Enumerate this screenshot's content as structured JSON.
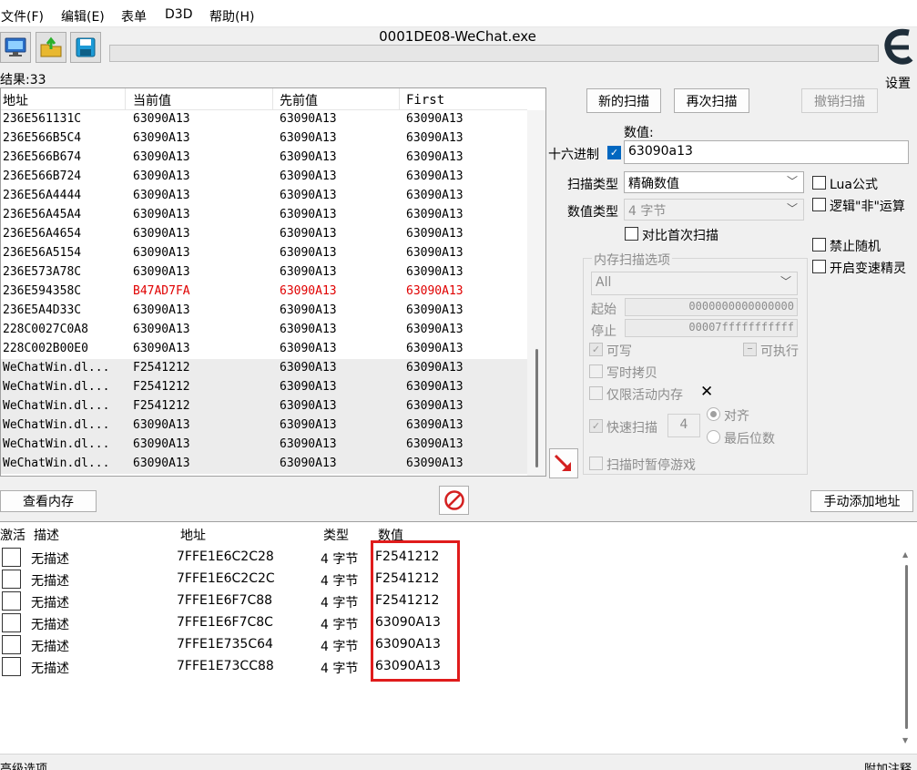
{
  "menu": [
    "文件(F)",
    "编辑(E)",
    "表单",
    "D3D",
    "帮助(H)"
  ],
  "window_title": "0001DE08-WeChat.exe",
  "settings_label": "设置",
  "found_count": "结果:33",
  "results": {
    "columns": [
      "地址",
      "当前值",
      "先前值",
      "First"
    ],
    "rows": [
      [
        "236E561131C",
        "63090A13",
        "63090A13",
        "63090A13"
      ],
      [
        "236E566B5C4",
        "63090A13",
        "63090A13",
        "63090A13"
      ],
      [
        "236E566B674",
        "63090A13",
        "63090A13",
        "63090A13"
      ],
      [
        "236E566B724",
        "63090A13",
        "63090A13",
        "63090A13"
      ],
      [
        "236E56A4444",
        "63090A13",
        "63090A13",
        "63090A13"
      ],
      [
        "236E56A45A4",
        "63090A13",
        "63090A13",
        "63090A13"
      ],
      [
        "236E56A4654",
        "63090A13",
        "63090A13",
        "63090A13"
      ],
      [
        "236E56A5154",
        "63090A13",
        "63090A13",
        "63090A13"
      ],
      [
        "236E573A78C",
        "63090A13",
        "63090A13",
        "63090A13"
      ],
      [
        "236E594358C",
        "B47AD7FA",
        "63090A13",
        "63090A13"
      ],
      [
        "236E5A4D33C",
        "63090A13",
        "63090A13",
        "63090A13"
      ],
      [
        "228C0027C0A8",
        "63090A13",
        "63090A13",
        "63090A13"
      ],
      [
        "228C002B00E0",
        "63090A13",
        "63090A13",
        "63090A13"
      ],
      [
        "WeChatWin.dl...",
        "F2541212",
        "63090A13",
        "63090A13"
      ],
      [
        "WeChatWin.dl...",
        "F2541212",
        "63090A13",
        "63090A13"
      ],
      [
        "WeChatWin.dl...",
        "F2541212",
        "63090A13",
        "63090A13"
      ],
      [
        "WeChatWin.dl...",
        "63090A13",
        "63090A13",
        "63090A13"
      ],
      [
        "WeChatWin.dl...",
        "63090A13",
        "63090A13",
        "63090A13"
      ],
      [
        "WeChatWin.dl...",
        "63090A13",
        "63090A13",
        "63090A13"
      ]
    ]
  },
  "scan": {
    "new_scan": "新的扫描",
    "next_scan": "再次扫描",
    "undo_scan": "撤销扫描",
    "value_label": "数值:",
    "hex_label": "十六进制",
    "hex_checked": true,
    "value": "63090a13",
    "scan_type_label": "扫描类型",
    "scan_type": "精确数值",
    "value_type_label": "数值类型",
    "value_type": "4 字节",
    "compare_first": "对比首次扫描",
    "lua_formula": "Lua公式",
    "logic_not": "逻辑\"非\"运算",
    "no_random": "禁止随机",
    "speedhack": "开启变速精灵",
    "mem_options_title": "内存扫描选项",
    "region": "All",
    "start_label": "起始",
    "start_value": "0000000000000000",
    "stop_label": "停止",
    "stop_value": "00007fffffffffff",
    "writable": "可写",
    "executable": "可执行",
    "copy_on_write": "写时拷贝",
    "active_memory_only": "仅限活动内存",
    "fast_scan": "快速扫描",
    "fast_scan_value": "4",
    "align": "对齐",
    "last_digits": "最后位数",
    "pause_game": "扫描时暂停游戏"
  },
  "view_memory": "查看内存",
  "add_address": "手动添加地址",
  "addresses": {
    "columns": [
      "激活",
      "描述",
      "地址",
      "类型",
      "数值"
    ],
    "rows": [
      [
        "无描述",
        "7FFE1E6C2C28",
        "4 字节",
        "F2541212"
      ],
      [
        "无描述",
        "7FFE1E6C2C2C",
        "4 字节",
        "F2541212"
      ],
      [
        "无描述",
        "7FFE1E6F7C88",
        "4 字节",
        "F2541212"
      ],
      [
        "无描述",
        "7FFE1E6F7C8C",
        "4 字节",
        "63090A13"
      ],
      [
        "无描述",
        "7FFE1E735C64",
        "4 字节",
        "63090A13"
      ],
      [
        "无描述",
        "7FFE1E73CC88",
        "4 字节",
        "63090A13"
      ]
    ]
  },
  "status_left": "高级选项",
  "status_right": "附加注释",
  "colors": {
    "highlight": "#e01b1b",
    "changed_value": "#e00000",
    "checkbox": "#0067c0"
  }
}
